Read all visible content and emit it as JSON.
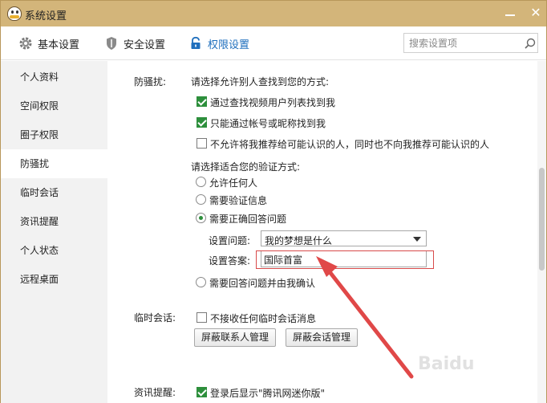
{
  "window": {
    "title": "系统设置"
  },
  "toolbar": {
    "tabs": [
      {
        "label": "基本设置",
        "icon": "gear-icon"
      },
      {
        "label": "安全设置",
        "icon": "shield-icon"
      },
      {
        "label": "权限设置",
        "icon": "lock-icon",
        "active": true
      }
    ],
    "search_placeholder": "搜索设置项"
  },
  "sidebar": {
    "items": [
      {
        "label": "个人资料"
      },
      {
        "label": "空间权限"
      },
      {
        "label": "圈子权限"
      },
      {
        "label": "防骚扰",
        "active": true
      },
      {
        "label": "临时会话"
      },
      {
        "label": "资讯提醒"
      },
      {
        "label": "个人状态"
      },
      {
        "label": "远程桌面"
      }
    ]
  },
  "anti_harass": {
    "label": "防骚扰:",
    "find_prompt": "请选择允许别人查找到您的方式:",
    "find_options": [
      {
        "label": "通过查找视频用户列表找到我",
        "checked": true
      },
      {
        "label": "只能通过帐号或昵称找到我",
        "checked": true
      },
      {
        "label": "不允许将我推荐给可能认识的人，同时也不向我推荐可能认识的人",
        "checked": false
      }
    ],
    "verify_prompt": "请选择适合您的验证方式:",
    "verify_options": [
      {
        "label": "允许任何人",
        "checked": false
      },
      {
        "label": "需要验证信息",
        "checked": false
      },
      {
        "label": "需要正确回答问题",
        "checked": true
      },
      {
        "label": "需要回答问题并由我确认",
        "checked": false
      }
    ],
    "question_label": "设置问题:",
    "question_value": "我的梦想是什么",
    "answer_label": "设置答案:",
    "answer_value": "国际首富"
  },
  "temp_session": {
    "label": "临时会话:",
    "option": {
      "label": "不接收任何临时会话消息",
      "checked": false
    },
    "buttons": [
      "屏蔽联系人管理",
      "屏蔽会话管理"
    ]
  },
  "news_alert": {
    "label": "资讯提醒:",
    "option": {
      "label": "登录后显示\"腾讯网迷你版\"",
      "checked": true
    }
  },
  "colors": {
    "titlebar": "#d3b57a",
    "accent": "#1f6fbd",
    "check": "#2d8f3c",
    "annotation": "#e04848"
  }
}
